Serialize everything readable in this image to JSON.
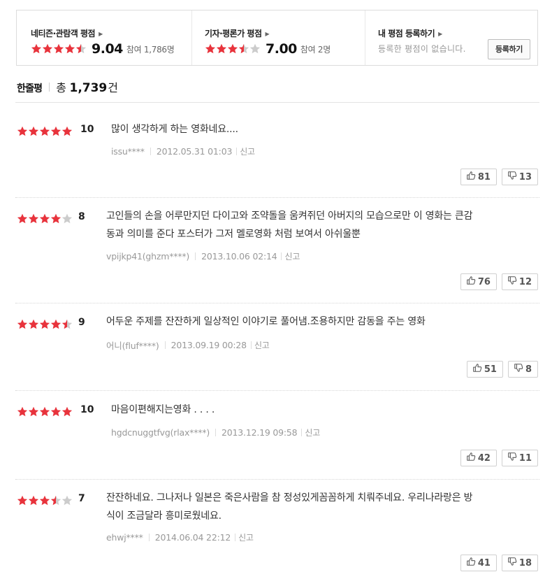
{
  "summary": {
    "audience": {
      "title": "네티즌·관람객 평점",
      "score": "9.04",
      "participation": "참여 1,786명",
      "rating": 4.5
    },
    "critics": {
      "title": "기자·평론가 평점",
      "score": "7.00",
      "participation": "참여 2명",
      "rating": 3.5
    },
    "mine": {
      "title": "내 평점 등록하기",
      "note": "등록한 평점이 없습니다.",
      "button": "등록하기"
    }
  },
  "header": {
    "label": "한줄평",
    "total_prefix": "총",
    "count": "1,739",
    "unit": "건"
  },
  "colors": {
    "star_on": "#e8333c",
    "star_off": "#cccccc"
  },
  "reviews": [
    {
      "rating": 5,
      "score": "10",
      "lines": [
        "많이 생각하게 하는 영화네요...."
      ],
      "user": "issu****",
      "date": "2012.05.31 01:03",
      "report": "신고",
      "like": "81",
      "dislike": "13"
    },
    {
      "rating": 4,
      "score": "8",
      "lines": [
        "고인들의 손을 어루만지던 다이고와 조약돌을 움켜쥐던 아버지의 모습으로만 이 영화는 큰감",
        "동과 의미를 준다 포스터가 그저 멜로영화 처럼 보여서 아쉬울뿐"
      ],
      "user": "vpijkp41(ghzm****)",
      "date": "2013.10.06 02:14",
      "report": "신고",
      "like": "76",
      "dislike": "12"
    },
    {
      "rating": 4.5,
      "score": "9",
      "lines": [
        "어두운 주제를 잔잔하게 일상적인 이야기로 풀어냄.조용하지만 감동을 주는 영화"
      ],
      "user": "어니(fluf****)",
      "date": "2013.09.19 00:28",
      "report": "신고",
      "like": "51",
      "dislike": "8"
    },
    {
      "rating": 5,
      "score": "10",
      "lines": [
        "마음이편해지는영화 . . . ."
      ],
      "user": "hgdcnuggtfvg(rlax****)",
      "date": "2013.12.19 09:58",
      "report": "신고",
      "like": "42",
      "dislike": "11"
    },
    {
      "rating": 3.5,
      "score": "7",
      "lines": [
        "잔잔하네요. 그나저나 일본은 죽은사람을 참 정성있게꼼꼼하게 치뤄주네요. 우리나라랑은 방",
        "식이 조금달라 흥미로웠네요."
      ],
      "user": "ehwj****",
      "date": "2014.06.04 22:12",
      "report": "신고",
      "like": "41",
      "dislike": "18"
    }
  ]
}
